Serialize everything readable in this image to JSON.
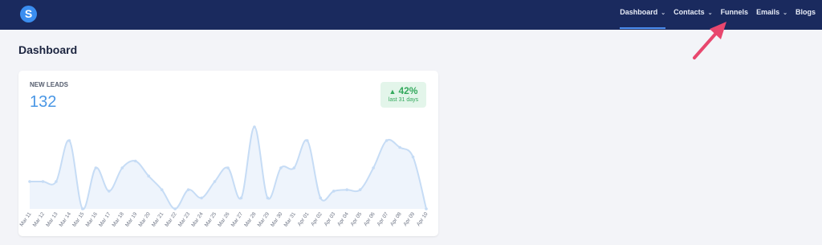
{
  "app": {
    "logo_letter": "S"
  },
  "nav": {
    "items": [
      {
        "label": "Dashboard",
        "has_dropdown": true,
        "active": true
      },
      {
        "label": "Contacts",
        "has_dropdown": true,
        "active": false
      },
      {
        "label": "Funnels",
        "has_dropdown": false,
        "active": false
      },
      {
        "label": "Emails",
        "has_dropdown": true,
        "active": false
      },
      {
        "label": "Blogs",
        "has_dropdown": false,
        "active": false
      }
    ]
  },
  "page": {
    "title": "Dashboard"
  },
  "card": {
    "label": "NEW LEADS",
    "value": "132",
    "badge": {
      "percent": "42%",
      "period": "last 31 days",
      "trend": "up"
    }
  },
  "colors": {
    "topbar": "#1a2a5e",
    "accent": "#4a97e5",
    "badge_green": "#34a95d",
    "badge_bg": "#e3f5ea",
    "annotation_arrow": "#e8476e"
  },
  "chart_data": {
    "type": "area",
    "x": [
      "Mar 11",
      "Mar 12",
      "Mar 13",
      "Mar 14",
      "Mar 15",
      "Mar 16",
      "Mar 17",
      "Mar 18",
      "Mar 19",
      "Mar 20",
      "Mar 21",
      "Mar 22",
      "Mar 23",
      "Mar 24",
      "Mar 25",
      "Mar 26",
      "Mar 27",
      "Mar 28",
      "Mar 29",
      "Mar 30",
      "Mar 31",
      "Apr 01",
      "Apr 02",
      "Apr 03",
      "Apr 04",
      "Apr 05",
      "Apr 06",
      "Apr 07",
      "Apr 08",
      "Apr 09",
      "Apr 10"
    ],
    "values": [
      2,
      2,
      2,
      5,
      0,
      3,
      1.3,
      3,
      3.5,
      2.4,
      1.4,
      0,
      1.4,
      0.8,
      2,
      3,
      0.8,
      6,
      0.8,
      3,
      3,
      5,
      0.8,
      1.3,
      1.4,
      1.4,
      3,
      5,
      4.5,
      3.8,
      0
    ],
    "ylim": [
      0,
      6
    ],
    "grid": false,
    "legend": "none"
  }
}
